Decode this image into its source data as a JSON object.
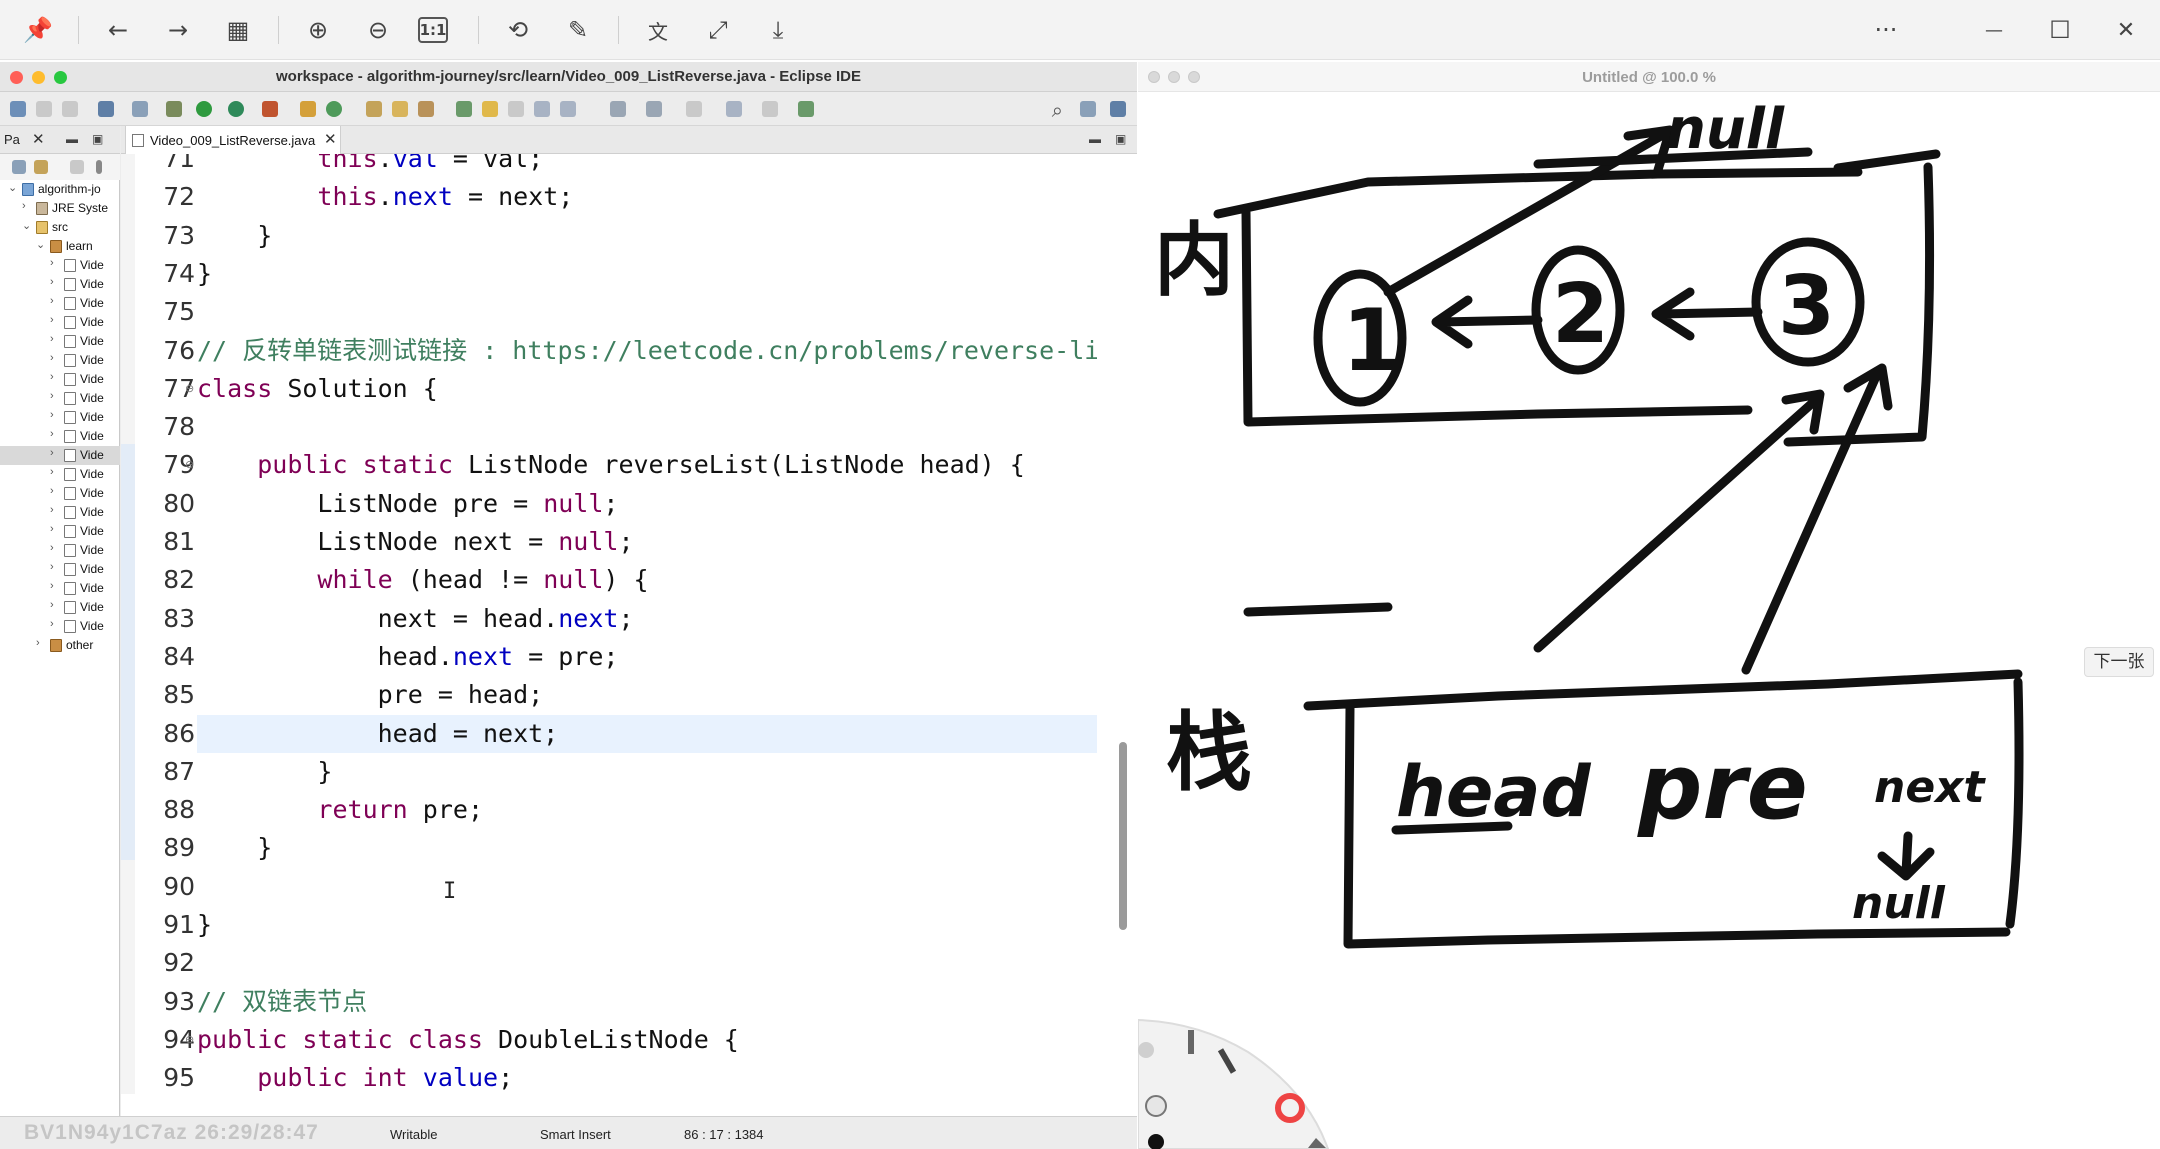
{
  "viewer": {
    "toolbar": {
      "pin": "📌",
      "back": "←",
      "forward": "→",
      "grid": "▦",
      "zoom_in": "⊕",
      "zoom_out": "⊖",
      "actual_size": "1:1",
      "rotate": "⟲",
      "edit": "✎",
      "translate": "文",
      "crop": "⤢",
      "save": "⤓",
      "more": "···",
      "minimize": "—",
      "maximize": "☐",
      "close": "✕"
    }
  },
  "eclipse": {
    "title": "workspace - algorithm-journey/src/learn/Video_009_ListReverse.java - Eclipse IDE",
    "package_explorer": {
      "tab_label": "Pa",
      "close": "✕",
      "items": [
        {
          "label": "algorithm-jo",
          "indent": 0,
          "arrow": "⌄",
          "icon": "proj"
        },
        {
          "label": "JRE Syste",
          "indent": 1,
          "arrow": "›",
          "icon": "lib"
        },
        {
          "label": "src",
          "indent": 1,
          "arrow": "⌄",
          "icon": "folder"
        },
        {
          "label": "learn",
          "indent": 2,
          "arrow": "⌄",
          "icon": "pkg"
        },
        {
          "label": "Vide",
          "indent": 3,
          "arrow": "›",
          "icon": "file"
        },
        {
          "label": "Vide",
          "indent": 3,
          "arrow": "›",
          "icon": "file"
        },
        {
          "label": "Vide",
          "indent": 3,
          "arrow": "›",
          "icon": "file"
        },
        {
          "label": "Vide",
          "indent": 3,
          "arrow": "›",
          "icon": "file"
        },
        {
          "label": "Vide",
          "indent": 3,
          "arrow": "›",
          "icon": "file"
        },
        {
          "label": "Vide",
          "indent": 3,
          "arrow": "›",
          "icon": "file"
        },
        {
          "label": "Vide",
          "indent": 3,
          "arrow": "›",
          "icon": "file"
        },
        {
          "label": "Vide",
          "indent": 3,
          "arrow": "›",
          "icon": "file"
        },
        {
          "label": "Vide",
          "indent": 3,
          "arrow": "›",
          "icon": "file"
        },
        {
          "label": "Vide",
          "indent": 3,
          "arrow": "›",
          "icon": "file"
        },
        {
          "label": "Vide",
          "indent": 3,
          "arrow": "›",
          "icon": "file",
          "selected": true
        },
        {
          "label": "Vide",
          "indent": 3,
          "arrow": "›",
          "icon": "file"
        },
        {
          "label": "Vide",
          "indent": 3,
          "arrow": "›",
          "icon": "file"
        },
        {
          "label": "Vide",
          "indent": 3,
          "arrow": "›",
          "icon": "file"
        },
        {
          "label": "Vide",
          "indent": 3,
          "arrow": "›",
          "icon": "file"
        },
        {
          "label": "Vide",
          "indent": 3,
          "arrow": "›",
          "icon": "file"
        },
        {
          "label": "Vide",
          "indent": 3,
          "arrow": "›",
          "icon": "file"
        },
        {
          "label": "Vide",
          "indent": 3,
          "arrow": "›",
          "icon": "file"
        },
        {
          "label": "Vide",
          "indent": 3,
          "arrow": "›",
          "icon": "file"
        },
        {
          "label": "Vide",
          "indent": 3,
          "arrow": "›",
          "icon": "file"
        },
        {
          "label": "other",
          "indent": 2,
          "arrow": "›",
          "icon": "pkg"
        }
      ]
    },
    "editor": {
      "tab_label": "Video_009_ListReverse.java",
      "tab_close": "✕",
      "current_line": 86,
      "lines": [
        {
          "n": "71",
          "tokens": [
            [
              "",
              "        "
            ],
            [
              "kw",
              "this"
            ],
            [
              "",
              "."
            ],
            [
              "fld",
              "val"
            ],
            [
              "",
              " = val;"
            ]
          ]
        },
        {
          "n": "72",
          "tokens": [
            [
              "",
              "        "
            ],
            [
              "kw",
              "this"
            ],
            [
              "",
              "."
            ],
            [
              "fld",
              "next"
            ],
            [
              "",
              " = next;"
            ]
          ]
        },
        {
          "n": "73",
          "tokens": [
            [
              "",
              "    }"
            ]
          ]
        },
        {
          "n": "74",
          "tokens": [
            [
              "",
              "}"
            ]
          ]
        },
        {
          "n": "75",
          "tokens": []
        },
        {
          "n": "76",
          "tokens": [
            [
              "cm",
              "// 反转单链表测试链接 : https://leetcode.cn/problems/reverse-linked-list/"
            ]
          ]
        },
        {
          "n": "77",
          "fold": true,
          "tokens": [
            [
              "kw",
              "class"
            ],
            [
              "",
              " Solution {"
            ]
          ]
        },
        {
          "n": "78",
          "tokens": []
        },
        {
          "n": "79",
          "fold": true,
          "tokens": [
            [
              "",
              "    "
            ],
            [
              "kw",
              "public static"
            ],
            [
              "",
              " ListNode reverseList(ListNode head) {"
            ]
          ]
        },
        {
          "n": "80",
          "tokens": [
            [
              "",
              "        ListNode pre = "
            ],
            [
              "kw",
              "null"
            ],
            [
              "",
              ";"
            ]
          ]
        },
        {
          "n": "81",
          "tokens": [
            [
              "",
              "        ListNode next = "
            ],
            [
              "kw",
              "null"
            ],
            [
              "",
              ";"
            ]
          ]
        },
        {
          "n": "82",
          "tokens": [
            [
              "",
              "        "
            ],
            [
              "kw",
              "while"
            ],
            [
              "",
              " (head != "
            ],
            [
              "kw",
              "null"
            ],
            [
              "",
              ") {"
            ]
          ]
        },
        {
          "n": "83",
          "tokens": [
            [
              "",
              "            next = head."
            ],
            [
              "fld",
              "next"
            ],
            [
              "",
              ";"
            ]
          ]
        },
        {
          "n": "84",
          "tokens": [
            [
              "",
              "            head."
            ],
            [
              "fld",
              "next"
            ],
            [
              "",
              " = pre;"
            ]
          ]
        },
        {
          "n": "85",
          "tokens": [
            [
              "",
              "            pre = head;"
            ]
          ]
        },
        {
          "n": "86",
          "tokens": [
            [
              "",
              "            head = next;"
            ]
          ]
        },
        {
          "n": "87",
          "tokens": [
            [
              "",
              "        }"
            ]
          ]
        },
        {
          "n": "88",
          "tokens": [
            [
              "",
              "        "
            ],
            [
              "kw",
              "return"
            ],
            [
              "",
              " pre;"
            ]
          ]
        },
        {
          "n": "89",
          "tokens": [
            [
              "",
              "    }"
            ]
          ]
        },
        {
          "n": "90",
          "tokens": []
        },
        {
          "n": "91",
          "tokens": [
            [
              "",
              "}"
            ]
          ]
        },
        {
          "n": "92",
          "tokens": []
        },
        {
          "n": "93",
          "tokens": [
            [
              "cm",
              "// 双链表节点"
            ]
          ]
        },
        {
          "n": "94",
          "fold": true,
          "tokens": [
            [
              "kw",
              "public static class"
            ],
            [
              "",
              " DoubleListNode {"
            ]
          ]
        },
        {
          "n": "95",
          "tokens": [
            [
              "",
              "    "
            ],
            [
              "kw",
              "public int"
            ],
            [
              "",
              " "
            ],
            [
              "fld",
              "value"
            ],
            [
              "",
              ";"
            ]
          ]
        }
      ]
    },
    "status": {
      "mode": "Writable",
      "insert": "Smart Insert",
      "position": "86 : 17 : 1384",
      "watermark": "BV1N94y1C7az 26:29/28:47"
    }
  },
  "whiteboard": {
    "title": "Untitled @ 100.0 %",
    "next_button": "下一张",
    "labels": {
      "heap": "内",
      "stack": "栈",
      "null_top": "null",
      "node1": "1",
      "node2": "2",
      "node3": "3",
      "head": "head",
      "pre": "pre",
      "next": "next",
      "null_bottom": "null"
    }
  }
}
